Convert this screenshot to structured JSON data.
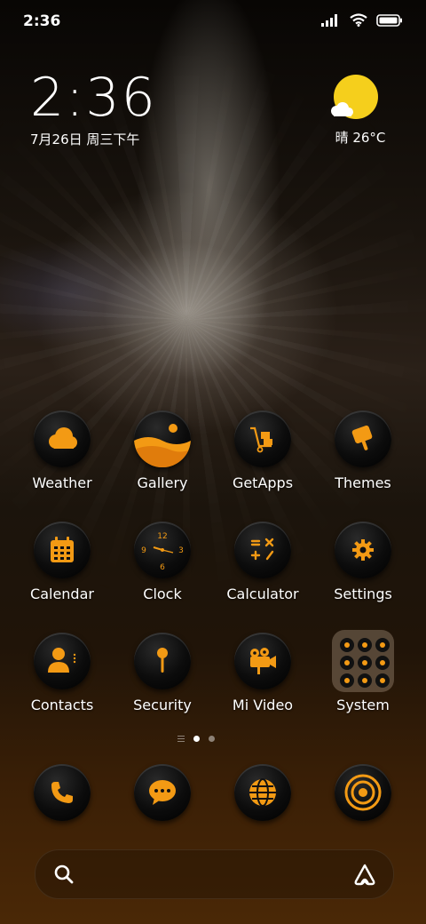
{
  "status_bar": {
    "time": "2:36",
    "icons": [
      "signal-icon",
      "wifi-icon",
      "battery-icon"
    ]
  },
  "clock_widget": {
    "time": "2:36",
    "date": "7月26日 周三下午"
  },
  "weather_widget": {
    "text": "晴 26°C",
    "icon": "sun-cloud-icon"
  },
  "apps": [
    {
      "label": "Weather",
      "icon": "cloud-icon"
    },
    {
      "label": "Gallery",
      "icon": "landscape-icon"
    },
    {
      "label": "GetApps",
      "icon": "cart-icon"
    },
    {
      "label": "Themes",
      "icon": "brush-icon"
    },
    {
      "label": "Calendar",
      "icon": "calendar-icon"
    },
    {
      "label": "Clock",
      "icon": "clock-icon"
    },
    {
      "label": "Calculator",
      "icon": "calculator-icon"
    },
    {
      "label": "Settings",
      "icon": "gear-icon"
    },
    {
      "label": "Contacts",
      "icon": "person-icon"
    },
    {
      "label": "Security",
      "icon": "key-icon"
    },
    {
      "label": "Mi Video",
      "icon": "video-camera-icon"
    },
    {
      "label": "System",
      "icon": "folder-icon"
    }
  ],
  "clock_face_numbers": [
    "12",
    "3",
    "6",
    "9"
  ],
  "dock": [
    {
      "icon": "phone-icon"
    },
    {
      "icon": "message-icon"
    },
    {
      "icon": "browser-icon"
    },
    {
      "icon": "camera-icon"
    }
  ],
  "page_indicator": {
    "current": 1,
    "total": 2
  },
  "colors": {
    "accent": "#f39a14",
    "sun": "#f5cf1c"
  }
}
